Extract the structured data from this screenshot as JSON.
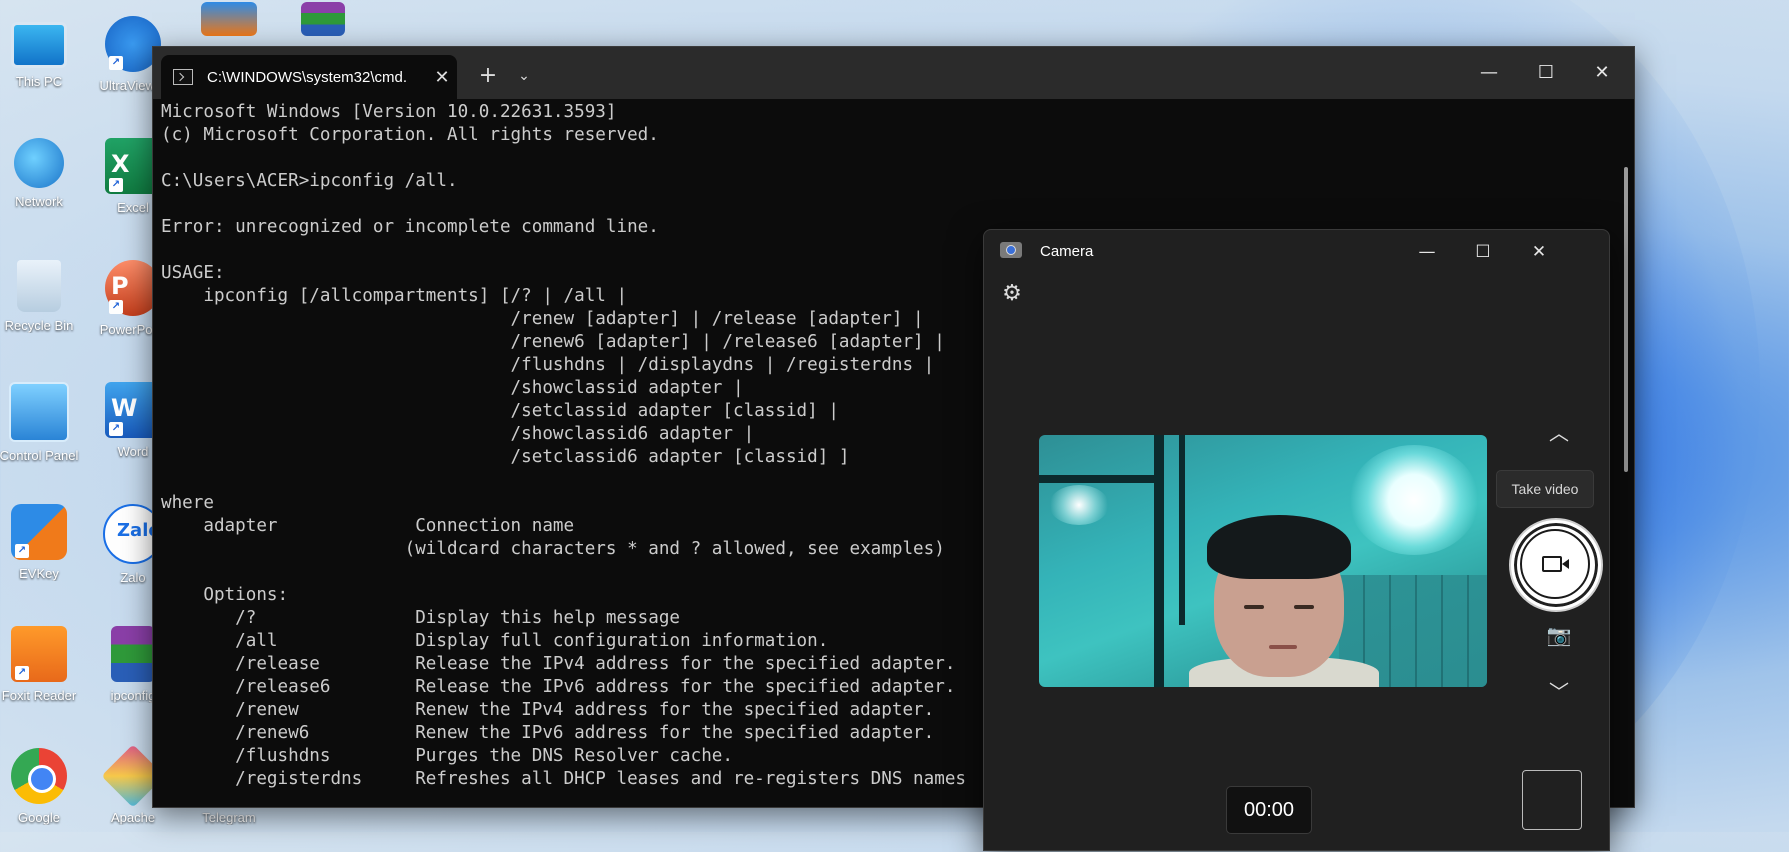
{
  "desktop": {
    "icons": [
      {
        "label": "This PC"
      },
      {
        "label": "UltraViewer"
      },
      {
        "label": "Network"
      },
      {
        "label": "Excel"
      },
      {
        "label": "Recycle Bin"
      },
      {
        "label": "PowerPoint"
      },
      {
        "label": "Control Panel"
      },
      {
        "label": "Word"
      },
      {
        "label": "EVKey"
      },
      {
        "label": "Zalo"
      },
      {
        "label": "Foxit Reader"
      },
      {
        "label": "ipconfig"
      },
      {
        "label": "Google"
      },
      {
        "label": "Apache"
      },
      {
        "label": "Telegram"
      }
    ]
  },
  "terminal": {
    "tab_title": "C:\\WINDOWS\\system32\\cmd.",
    "new_tab_icon": "plus-icon",
    "lines": [
      "Microsoft Windows [Version 10.0.22631.3593]",
      "(c) Microsoft Corporation. All rights reserved.",
      "",
      "C:\\Users\\ACER>ipconfig /all.",
      "",
      "Error: unrecognized or incomplete command line.",
      "",
      "USAGE:",
      "    ipconfig [/allcompartments] [/? | /all |",
      "                                 /renew [adapter] | /release [adapter] |",
      "                                 /renew6 [adapter] | /release6 [adapter] |",
      "                                 /flushdns | /displaydns | /registerdns |",
      "                                 /showclassid adapter |",
      "                                 /setclassid adapter [classid] |",
      "                                 /showclassid6 adapter |",
      "                                 /setclassid6 adapter [classid] ]",
      "",
      "where",
      "    adapter             Connection name",
      "                       (wildcard characters * and ? allowed, see examples)",
      "",
      "    Options:",
      "       /?               Display this help message",
      "       /all             Display full configuration information.",
      "       /release         Release the IPv4 address for the specified adapter.",
      "       /release6        Release the IPv6 address for the specified adapter.",
      "       /renew           Renew the IPv4 address for the specified adapter.",
      "       /renew6          Renew the IPv6 address for the specified adapter.",
      "       /flushdns        Purges the DNS Resolver cache.",
      "       /registerdns     Refreshes all DHCP leases and re-registers DNS names"
    ]
  },
  "camera": {
    "title": "Camera",
    "take_video_label": "Take video",
    "timer": "00:00"
  }
}
